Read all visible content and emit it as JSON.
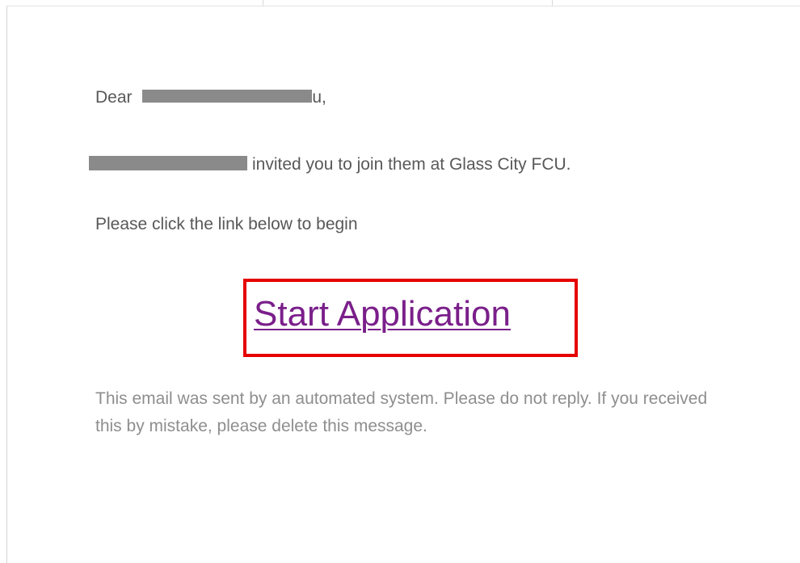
{
  "email": {
    "greeting_prefix": "Dear ",
    "greeting_suffix": "u,",
    "invite_text": "invited you to join them at Glass City FCU.",
    "instruction": "Please click the link below to begin",
    "cta_label": "Start Application",
    "disclaimer": "This email was sent by an automated system. Please do not reply. If you received this by mistake, please delete this message."
  },
  "colors": {
    "body_text": "#585858",
    "link": "#7a1f8a",
    "highlight_border": "#e60000",
    "disclaimer_text": "#8e8e8e",
    "redaction": "#8a8a8a"
  }
}
